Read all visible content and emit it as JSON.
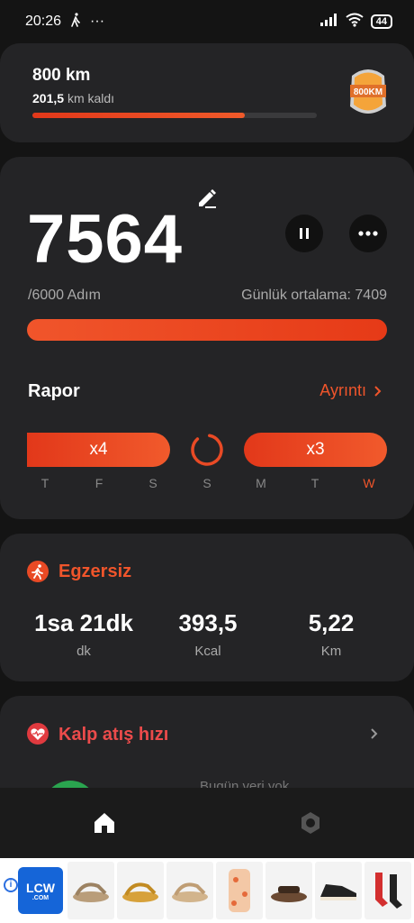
{
  "status_bar": {
    "time": "20:26",
    "walk_icon": "walking-person-icon",
    "overflow": "···",
    "battery": "44"
  },
  "goal_card": {
    "title": "800 km",
    "remaining_value": "201,5",
    "remaining_label": "km kaldı",
    "progress": 0.748,
    "badge_text": "800KM"
  },
  "steps": {
    "count": "7564",
    "goal": "/6000 Adım",
    "daily_average": "Günlük ortalama: 7409",
    "progress": 1.0
  },
  "report": {
    "title": "Rapor",
    "link": "Ayrıntı",
    "streak_left": "x4",
    "streak_right": "x3",
    "days": [
      "T",
      "F",
      "S",
      "S",
      "M",
      "T",
      "W"
    ],
    "today_index": 6
  },
  "exercise": {
    "title": "Egzersiz",
    "stats": [
      {
        "value": "1sa 21dk",
        "unit": "dk"
      },
      {
        "value": "393,5",
        "unit": "Kcal"
      },
      {
        "value": "5,22",
        "unit": "Km"
      }
    ]
  },
  "heart_rate": {
    "title": "Kalp atış hızı",
    "partial_text": "Bugün veri yok"
  },
  "nav": {
    "home": "home-icon",
    "settings": "settings-icon"
  },
  "ad": {
    "info": "i",
    "logo_big": "LCW",
    "logo_small": ".COM"
  },
  "colors": {
    "accent": "#f0552b",
    "heart": "#e03a3f",
    "card": "#242426",
    "background": "#141414"
  }
}
